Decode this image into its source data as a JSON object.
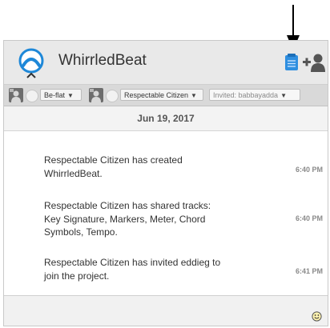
{
  "app": {
    "title": "WhirrledBeat"
  },
  "toolbar": {
    "key_label": "Be-flat",
    "user_label": "Respectable Citizen",
    "invited_label": "Invited: babbayadda"
  },
  "feed": {
    "date": "Jun 19, 2017",
    "messages": [
      {
        "line1": "Respectable Citizen has created",
        "line2": "WhirrledBeat.",
        "line3": "",
        "time": "6:40 PM"
      },
      {
        "line1": "Respectable Citizen has shared tracks:",
        "line2": "Key Signature, Markers, Meter, Chord",
        "line3": "Symbols, Tempo.",
        "time": "6:40 PM"
      },
      {
        "line1": "Respectable Citizen has invited eddieg to",
        "line2": "join the project.",
        "line3": "",
        "time": "6:41 PM"
      }
    ]
  },
  "icons": {
    "logo": "whirrledbeat-logo",
    "notes": "notes-icon",
    "invite": "add-user-icon",
    "emoji": "smiley-icon",
    "pointer": "down-arrow-pointer"
  },
  "colors": {
    "accent": "#1e88d8",
    "header_bg": "#e9e9e9",
    "toolbar_bg": "#d9d9d9"
  }
}
